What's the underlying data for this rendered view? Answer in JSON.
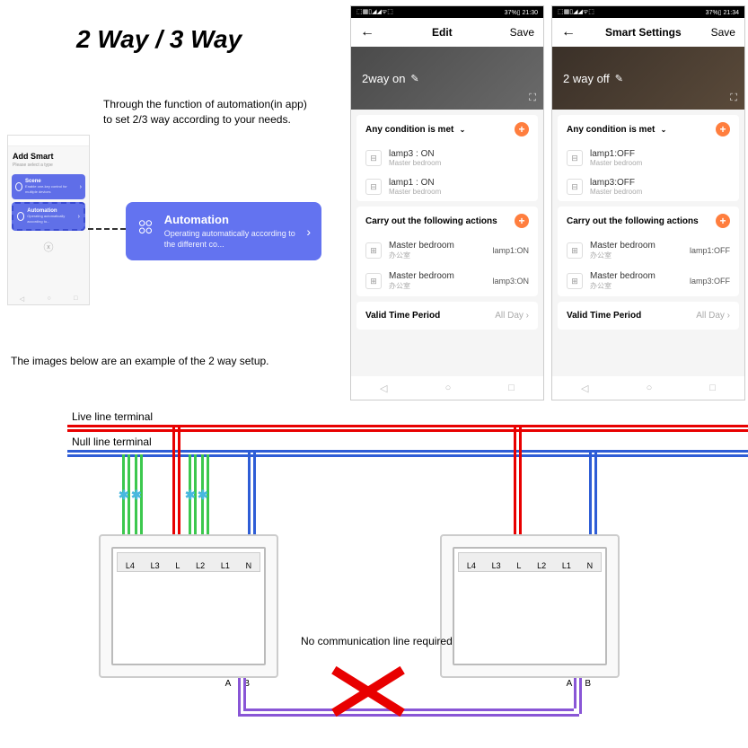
{
  "title": "2 Way / 3 Way",
  "desc1_line1": "Through the function of  automation(in app)",
  "desc1_line2": "to set  2/3 way according to your needs.",
  "desc2": "The images below are an example of the 2 way setup.",
  "small_phone": {
    "title": "Add Smart",
    "subtitle": "Please select a type",
    "scene": {
      "name": "Scene",
      "sub": "Enable one-key control for multiple devices"
    },
    "auto": {
      "name": "Automation",
      "sub": "Operating automatically according to..."
    },
    "nav": [
      "◁",
      "○",
      "□"
    ]
  },
  "auto_card": {
    "title": "Automation",
    "subtitle": "Operating automatically according to the different co..."
  },
  "phones": [
    {
      "status_left": "⬚▦▯◢◢ᯤ⬚",
      "status_right": "37%▯ 21:30",
      "header_title": "Edit",
      "header_save": "Save",
      "banner": "2way on",
      "cond_title": "Any condition is met",
      "conds": [
        {
          "line1": "lamp3 : ON",
          "line2": "Master bedroom"
        },
        {
          "line1": "lamp1 : ON",
          "line2": "Master bedroom"
        }
      ],
      "act_title": "Carry out the following actions",
      "acts": [
        {
          "line1": "Master bedroom",
          "line2": "办公室",
          "right": "lamp1:ON"
        },
        {
          "line1": "Master bedroom",
          "line2": "办公室",
          "right": "lamp3:ON"
        }
      ],
      "valid_label": "Valid Time Period",
      "valid_value": "All Day"
    },
    {
      "status_left": "⬚▦▯◢◢ᯤ⬚",
      "status_right": "37%▯ 21:34",
      "header_title": "Smart Settings",
      "header_save": "Save",
      "banner": "2 way off",
      "cond_title": "Any condition is met",
      "conds": [
        {
          "line1": "lamp1:OFF",
          "line2": "Master bedroom"
        },
        {
          "line1": "lamp3:OFF",
          "line2": "Master bedroom"
        }
      ],
      "act_title": "Carry out the following actions",
      "acts": [
        {
          "line1": "Master bedroom",
          "line2": "办公室",
          "right": "lamp1:OFF"
        },
        {
          "line1": "Master bedroom",
          "line2": "办公室",
          "right": "lamp3:OFF"
        }
      ],
      "valid_label": "Valid Time Period",
      "valid_value": "All Day"
    }
  ],
  "diagram": {
    "live": "Live line terminal",
    "null": "Null line terminal",
    "terminals": [
      "L4",
      "L3",
      "L",
      "L2",
      "L1",
      "N"
    ],
    "ab": [
      "A",
      "B"
    ],
    "nocomm": "No communication line required"
  }
}
